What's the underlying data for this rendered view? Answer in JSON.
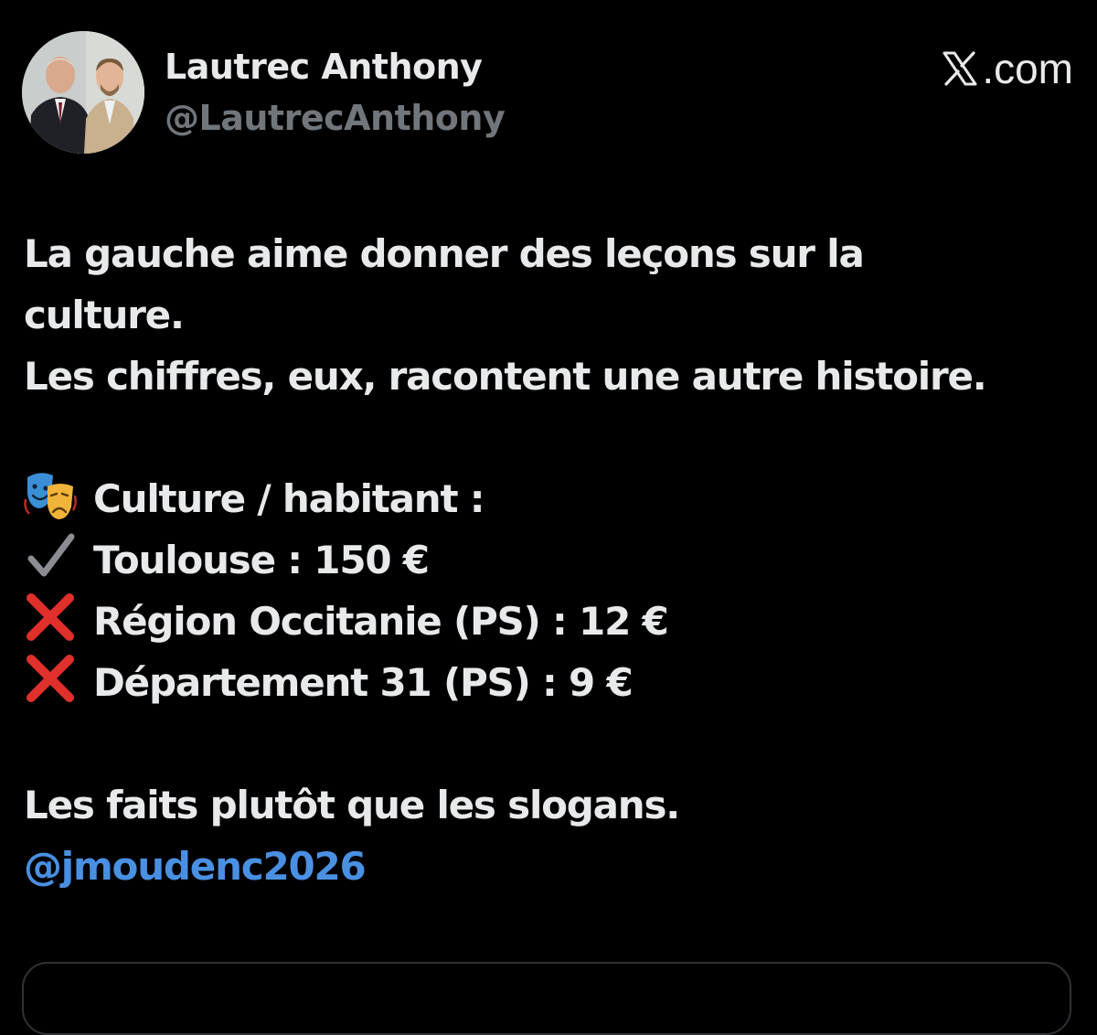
{
  "post": {
    "author_name": "Lautrec Anthony",
    "author_handle": "@LautrecAnthony",
    "source_label": ".com",
    "intro_line_1": "La gauche aime donner des leçons sur la",
    "intro_line_2": "culture.",
    "intro_line_3": "Les chiffres, eux, racontent une autre histoire.",
    "stats_heading": "Culture / habitant :",
    "stat_1": "Toulouse : 150 €",
    "stat_2": "Région Occitanie (PS) : 12 €",
    "stat_3": "Département 31 (PS) : 9 €",
    "closing_line": "Les faits plutôt que les slogans.",
    "mention": "@jmoudenc2026"
  },
  "icons": {
    "source_logo": "x-logo-icon",
    "heading_emoji": "performing-arts-masks-icon",
    "stat_1_emoji": "check-mark-icon",
    "stat_2_emoji": "cross-mark-icon",
    "stat_3_emoji": "cross-mark-icon"
  },
  "colors": {
    "background": "#000000",
    "text_primary": "#e7e9ea",
    "text_secondary": "#71767b",
    "mention": "#4a90e2",
    "cross_mark": "#e0302c",
    "check_mark": "#8a8d91",
    "card_border": "#2f3336"
  }
}
